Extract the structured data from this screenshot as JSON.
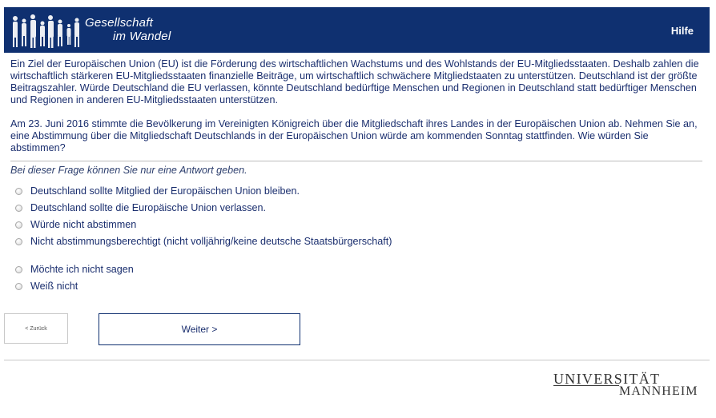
{
  "header": {
    "logo_line1": "Gesellschaft",
    "logo_line2": "im Wandel",
    "help_label": "Hilfe",
    "background_color": "#0f3070"
  },
  "question": {
    "paragraph1": "Ein Ziel der Europäischen Union (EU) ist die Förderung des wirtschaftlichen Wachstums und des Wohlstands der EU-Mitgliedsstaaten. Deshalb zahlen die wirtschaftlich stärkeren EU-Mitgliedsstaaten finanzielle Beiträge, um wirtschaftlich schwächere Mitgliedstaaten zu unterstützen. Deutschland ist der größte Beitragszahler. Würde Deutschland die EU verlassen, könnte Deutschland bedürftige Menschen und Regionen in Deutschland statt bedürftiger Menschen und Regionen in anderen EU-Mitgliedsstaaten unterstützen.",
    "paragraph2": "Am 23. Juni 2016 stimmte die Bevölkerung im Vereinigten Königreich über die Mitgliedschaft ihres Landes in der Europäischen Union ab. Nehmen Sie an, eine Abstimmung über die Mitgliedschaft Deutschlands in der Europäischen Union würde am kommenden Sonntag stattfinden. Wie würden Sie abstimmen?",
    "hint": "Bei dieser Frage können Sie nur eine Antwort geben."
  },
  "options": [
    {
      "label": "Deutschland sollte Mitglied der Europäischen Union bleiben.",
      "selected": false
    },
    {
      "label": "Deutschland sollte die Europäische Union verlassen.",
      "selected": false
    },
    {
      "label": "Würde nicht abstimmen",
      "selected": false
    },
    {
      "label": "Nicht abstimmungsberechtigt (nicht volljährig/keine deutsche Staatsbürgerschaft)",
      "selected": false
    },
    {
      "label": "Möchte ich nicht sagen",
      "selected": false
    },
    {
      "label": "Weiß nicht",
      "selected": false
    }
  ],
  "navigation": {
    "back_label": "< Zurück",
    "next_label": "Weiter >"
  },
  "footer": {
    "logo_line1": "UNIVERSITÄT",
    "logo_line2": "MANNHEIM"
  }
}
